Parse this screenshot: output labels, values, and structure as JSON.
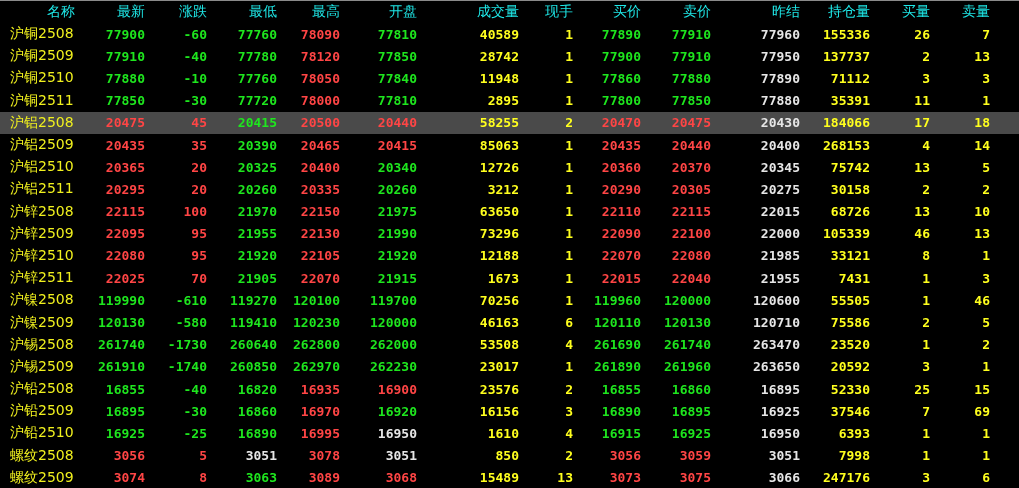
{
  "columns": [
    {
      "label": "名称",
      "kind": "name"
    },
    {
      "label": "最新",
      "kind": "price"
    },
    {
      "label": "涨跌",
      "kind": "price"
    },
    {
      "label": "最低",
      "kind": "price"
    },
    {
      "label": "最高",
      "kind": "price"
    },
    {
      "label": "开盘",
      "kind": "price"
    },
    {
      "label": "成交量",
      "kind": "volume"
    },
    {
      "label": "现手",
      "kind": "volume"
    },
    {
      "label": "买价",
      "kind": "price"
    },
    {
      "label": "卖价",
      "kind": "price"
    },
    {
      "label": "昨结",
      "kind": "settle"
    },
    {
      "label": "持仓量",
      "kind": "volume"
    },
    {
      "label": "买量",
      "kind": "volume"
    },
    {
      "label": "卖量",
      "kind": "volume"
    }
  ],
  "rows": [
    {
      "name": "沪铜2508",
      "selected": false,
      "cells": [
        {
          "text": "77900",
          "color": "#1ee61e"
        },
        {
          "text": "-60",
          "color": "#1ee61e"
        },
        {
          "text": "77760",
          "color": "#1ee61e"
        },
        {
          "text": "78090",
          "color": "#ff4545"
        },
        {
          "text": "77810",
          "color": "#1ee61e"
        },
        "40589",
        "1",
        {
          "text": "77890",
          "color": "#1ee61e"
        },
        {
          "text": "77910",
          "color": "#1ee61e"
        },
        "77960",
        "155336",
        "26",
        "7"
      ]
    },
    {
      "name": "沪铜2509",
      "selected": false,
      "cells": [
        {
          "text": "77910",
          "color": "#1ee61e"
        },
        {
          "text": "-40",
          "color": "#1ee61e"
        },
        {
          "text": "77780",
          "color": "#1ee61e"
        },
        {
          "text": "78120",
          "color": "#ff4545"
        },
        {
          "text": "77850",
          "color": "#1ee61e"
        },
        "28742",
        "1",
        {
          "text": "77900",
          "color": "#1ee61e"
        },
        {
          "text": "77910",
          "color": "#1ee61e"
        },
        "77950",
        "137737",
        "2",
        "13"
      ]
    },
    {
      "name": "沪铜2510",
      "selected": false,
      "cells": [
        {
          "text": "77880",
          "color": "#1ee61e"
        },
        {
          "text": "-10",
          "color": "#1ee61e"
        },
        {
          "text": "77760",
          "color": "#1ee61e"
        },
        {
          "text": "78050",
          "color": "#ff4545"
        },
        {
          "text": "77840",
          "color": "#1ee61e"
        },
        "11948",
        "1",
        {
          "text": "77860",
          "color": "#1ee61e"
        },
        {
          "text": "77880",
          "color": "#1ee61e"
        },
        "77890",
        "71112",
        "3",
        "3"
      ]
    },
    {
      "name": "沪铜2511",
      "selected": false,
      "cells": [
        {
          "text": "77850",
          "color": "#1ee61e"
        },
        {
          "text": "-30",
          "color": "#1ee61e"
        },
        {
          "text": "77720",
          "color": "#1ee61e"
        },
        {
          "text": "78000",
          "color": "#ff4545"
        },
        {
          "text": "77810",
          "color": "#1ee61e"
        },
        "2895",
        "1",
        {
          "text": "77800",
          "color": "#1ee61e"
        },
        {
          "text": "77850",
          "color": "#1ee61e"
        },
        "77880",
        "35391",
        "11",
        "1"
      ]
    },
    {
      "name": "沪铝2508",
      "selected": true,
      "cells": [
        {
          "text": "20475",
          "color": "#ff4545"
        },
        {
          "text": "45",
          "color": "#ff4545"
        },
        {
          "text": "20415",
          "color": "#1ee61e"
        },
        {
          "text": "20500",
          "color": "#ff4545"
        },
        {
          "text": "20440",
          "color": "#ff4545"
        },
        "58255",
        "2",
        {
          "text": "20470",
          "color": "#ff4545"
        },
        {
          "text": "20475",
          "color": "#ff4545"
        },
        "20430",
        "184066",
        "17",
        "18"
      ]
    },
    {
      "name": "沪铝2509",
      "selected": false,
      "cells": [
        {
          "text": "20435",
          "color": "#ff4545"
        },
        {
          "text": "35",
          "color": "#ff4545"
        },
        {
          "text": "20390",
          "color": "#1ee61e"
        },
        {
          "text": "20465",
          "color": "#ff4545"
        },
        {
          "text": "20415",
          "color": "#ff4545"
        },
        "85063",
        "1",
        {
          "text": "20435",
          "color": "#ff4545"
        },
        {
          "text": "20440",
          "color": "#ff4545"
        },
        "20400",
        "268153",
        "4",
        "14"
      ]
    },
    {
      "name": "沪铝2510",
      "selected": false,
      "cells": [
        {
          "text": "20365",
          "color": "#ff4545"
        },
        {
          "text": "20",
          "color": "#ff4545"
        },
        {
          "text": "20325",
          "color": "#1ee61e"
        },
        {
          "text": "20400",
          "color": "#ff4545"
        },
        {
          "text": "20340",
          "color": "#1ee61e"
        },
        "12726",
        "1",
        {
          "text": "20360",
          "color": "#ff4545"
        },
        {
          "text": "20370",
          "color": "#ff4545"
        },
        "20345",
        "75742",
        "13",
        "5"
      ]
    },
    {
      "name": "沪铝2511",
      "selected": false,
      "cells": [
        {
          "text": "20295",
          "color": "#ff4545"
        },
        {
          "text": "20",
          "color": "#ff4545"
        },
        {
          "text": "20260",
          "color": "#1ee61e"
        },
        {
          "text": "20335",
          "color": "#ff4545"
        },
        {
          "text": "20260",
          "color": "#1ee61e"
        },
        "3212",
        "1",
        {
          "text": "20290",
          "color": "#ff4545"
        },
        {
          "text": "20305",
          "color": "#ff4545"
        },
        "20275",
        "30158",
        "2",
        "2"
      ]
    },
    {
      "name": "沪锌2508",
      "selected": false,
      "cells": [
        {
          "text": "22115",
          "color": "#ff4545"
        },
        {
          "text": "100",
          "color": "#ff4545"
        },
        {
          "text": "21970",
          "color": "#1ee61e"
        },
        {
          "text": "22150",
          "color": "#ff4545"
        },
        {
          "text": "21975",
          "color": "#1ee61e"
        },
        "63650",
        "1",
        {
          "text": "22110",
          "color": "#ff4545"
        },
        {
          "text": "22115",
          "color": "#ff4545"
        },
        "22015",
        "68726",
        "13",
        "10"
      ]
    },
    {
      "name": "沪锌2509",
      "selected": false,
      "cells": [
        {
          "text": "22095",
          "color": "#ff4545"
        },
        {
          "text": "95",
          "color": "#ff4545"
        },
        {
          "text": "21955",
          "color": "#1ee61e"
        },
        {
          "text": "22130",
          "color": "#ff4545"
        },
        {
          "text": "21990",
          "color": "#1ee61e"
        },
        "73296",
        "1",
        {
          "text": "22090",
          "color": "#ff4545"
        },
        {
          "text": "22100",
          "color": "#ff4545"
        },
        "22000",
        "105339",
        "46",
        "13"
      ]
    },
    {
      "name": "沪锌2510",
      "selected": false,
      "cells": [
        {
          "text": "22080",
          "color": "#ff4545"
        },
        {
          "text": "95",
          "color": "#ff4545"
        },
        {
          "text": "21920",
          "color": "#1ee61e"
        },
        {
          "text": "22105",
          "color": "#ff4545"
        },
        {
          "text": "21920",
          "color": "#1ee61e"
        },
        "12188",
        "1",
        {
          "text": "22070",
          "color": "#ff4545"
        },
        {
          "text": "22080",
          "color": "#ff4545"
        },
        "21985",
        "33121",
        "8",
        "1"
      ]
    },
    {
      "name": "沪锌2511",
      "selected": false,
      "cells": [
        {
          "text": "22025",
          "color": "#ff4545"
        },
        {
          "text": "70",
          "color": "#ff4545"
        },
        {
          "text": "21905",
          "color": "#1ee61e"
        },
        {
          "text": "22070",
          "color": "#ff4545"
        },
        {
          "text": "21915",
          "color": "#1ee61e"
        },
        "1673",
        "1",
        {
          "text": "22015",
          "color": "#ff4545"
        },
        {
          "text": "22040",
          "color": "#ff4545"
        },
        "21955",
        "7431",
        "1",
        "3"
      ]
    },
    {
      "name": "沪镍2508",
      "selected": false,
      "cells": [
        {
          "text": "119990",
          "color": "#1ee61e"
        },
        {
          "text": "-610",
          "color": "#1ee61e"
        },
        {
          "text": "119270",
          "color": "#1ee61e"
        },
        {
          "text": "120100",
          "color": "#1ee61e"
        },
        {
          "text": "119700",
          "color": "#1ee61e"
        },
        "70256",
        "1",
        {
          "text": "119960",
          "color": "#1ee61e"
        },
        {
          "text": "120000",
          "color": "#1ee61e"
        },
        "120600",
        "55505",
        "1",
        "46"
      ]
    },
    {
      "name": "沪镍2509",
      "selected": false,
      "cells": [
        {
          "text": "120130",
          "color": "#1ee61e"
        },
        {
          "text": "-580",
          "color": "#1ee61e"
        },
        {
          "text": "119410",
          "color": "#1ee61e"
        },
        {
          "text": "120230",
          "color": "#1ee61e"
        },
        {
          "text": "120000",
          "color": "#1ee61e"
        },
        "46163",
        "6",
        {
          "text": "120110",
          "color": "#1ee61e"
        },
        {
          "text": "120130",
          "color": "#1ee61e"
        },
        "120710",
        "75586",
        "2",
        "5"
      ]
    },
    {
      "name": "沪锡2508",
      "selected": false,
      "cells": [
        {
          "text": "261740",
          "color": "#1ee61e"
        },
        {
          "text": "-1730",
          "color": "#1ee61e"
        },
        {
          "text": "260640",
          "color": "#1ee61e"
        },
        {
          "text": "262800",
          "color": "#1ee61e"
        },
        {
          "text": "262000",
          "color": "#1ee61e"
        },
        "53508",
        "4",
        {
          "text": "261690",
          "color": "#1ee61e"
        },
        {
          "text": "261740",
          "color": "#1ee61e"
        },
        "263470",
        "23520",
        "1",
        "2"
      ]
    },
    {
      "name": "沪锡2509",
      "selected": false,
      "cells": [
        {
          "text": "261910",
          "color": "#1ee61e"
        },
        {
          "text": "-1740",
          "color": "#1ee61e"
        },
        {
          "text": "260850",
          "color": "#1ee61e"
        },
        {
          "text": "262970",
          "color": "#1ee61e"
        },
        {
          "text": "262230",
          "color": "#1ee61e"
        },
        "23017",
        "1",
        {
          "text": "261890",
          "color": "#1ee61e"
        },
        {
          "text": "261960",
          "color": "#1ee61e"
        },
        "263650",
        "20592",
        "3",
        "1"
      ]
    },
    {
      "name": "沪铅2508",
      "selected": false,
      "cells": [
        {
          "text": "16855",
          "color": "#1ee61e"
        },
        {
          "text": "-40",
          "color": "#1ee61e"
        },
        {
          "text": "16820",
          "color": "#1ee61e"
        },
        {
          "text": "16935",
          "color": "#ff4545"
        },
        {
          "text": "16900",
          "color": "#ff4545"
        },
        "23576",
        "2",
        {
          "text": "16855",
          "color": "#1ee61e"
        },
        {
          "text": "16860",
          "color": "#1ee61e"
        },
        "16895",
        "52330",
        "25",
        "15"
      ]
    },
    {
      "name": "沪铅2509",
      "selected": false,
      "cells": [
        {
          "text": "16895",
          "color": "#1ee61e"
        },
        {
          "text": "-30",
          "color": "#1ee61e"
        },
        {
          "text": "16860",
          "color": "#1ee61e"
        },
        {
          "text": "16970",
          "color": "#ff4545"
        },
        {
          "text": "16920",
          "color": "#1ee61e"
        },
        "16156",
        "3",
        {
          "text": "16890",
          "color": "#1ee61e"
        },
        {
          "text": "16895",
          "color": "#1ee61e"
        },
        "16925",
        "37546",
        "7",
        "69"
      ]
    },
    {
      "name": "沪铅2510",
      "selected": false,
      "cells": [
        {
          "text": "16925",
          "color": "#1ee61e"
        },
        {
          "text": "-25",
          "color": "#1ee61e"
        },
        {
          "text": "16890",
          "color": "#1ee61e"
        },
        {
          "text": "16995",
          "color": "#ff4545"
        },
        {
          "text": "16950",
          "color": "#e6e6e6"
        },
        "1610",
        "4",
        {
          "text": "16915",
          "color": "#1ee61e"
        },
        {
          "text": "16925",
          "color": "#1ee61e"
        },
        "16950",
        "6393",
        "1",
        "1"
      ]
    },
    {
      "name": "螺纹2508",
      "selected": false,
      "cells": [
        {
          "text": "3056",
          "color": "#ff4545"
        },
        {
          "text": "5",
          "color": "#ff4545"
        },
        {
          "text": "3051",
          "color": "#e6e6e6"
        },
        {
          "text": "3078",
          "color": "#ff4545"
        },
        {
          "text": "3051",
          "color": "#e6e6e6"
        },
        "850",
        "2",
        {
          "text": "3056",
          "color": "#ff4545"
        },
        {
          "text": "3059",
          "color": "#ff4545"
        },
        "3051",
        "7998",
        "1",
        "1"
      ]
    },
    {
      "name": "螺纹2509",
      "selected": false,
      "cells": [
        {
          "text": "3074",
          "color": "#ff4545"
        },
        {
          "text": "8",
          "color": "#ff4545"
        },
        {
          "text": "3063",
          "color": "#1ee61e"
        },
        {
          "text": "3089",
          "color": "#ff4545"
        },
        {
          "text": "3068",
          "color": "#ff4545"
        },
        "15489",
        "13",
        {
          "text": "3073",
          "color": "#ff4545"
        },
        {
          "text": "3075",
          "color": "#ff4545"
        },
        "3066",
        "247176",
        "3",
        "6"
      ]
    }
  ]
}
